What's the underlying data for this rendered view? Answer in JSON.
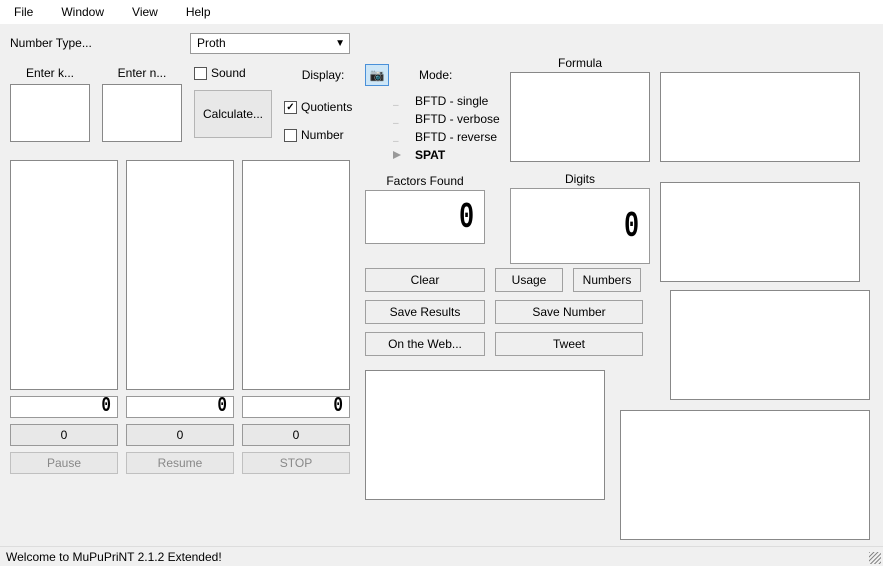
{
  "menu": {
    "file": "File",
    "window": "Window",
    "view": "View",
    "help": "Help"
  },
  "labels": {
    "number_type": "Number Type...",
    "enter_k": "Enter k...",
    "enter_n": "Enter n...",
    "sound": "Sound",
    "display": "Display:",
    "quotients": "Quotients",
    "number": "Number",
    "calculate": "Calculate...",
    "mode": "Mode:",
    "factors_found": "Factors Found",
    "formula": "Formula",
    "digits": "Digits"
  },
  "combo": {
    "number_type_value": "Proth"
  },
  "modes": {
    "m0": "BFTD - single",
    "m1": "BFTD - verbose",
    "m2": "BFTD - reverse",
    "m3": "SPAT"
  },
  "lcds": {
    "factors_found": "0",
    "digits": "0",
    "left0": "0",
    "left1": "0",
    "left2": "0"
  },
  "counters": {
    "c0": "0",
    "c1": "0",
    "c2": "0"
  },
  "buttons": {
    "pause": "Pause",
    "resume": "Resume",
    "stop": "STOP",
    "clear": "Clear",
    "usage": "Usage",
    "numbers": "Numbers",
    "save_results": "Save Results",
    "save_number": "Save Number",
    "on_web": "On the Web...",
    "tweet": "Tweet"
  },
  "status": "Welcome to MuPuPriNT 2.1.2 Extended!"
}
